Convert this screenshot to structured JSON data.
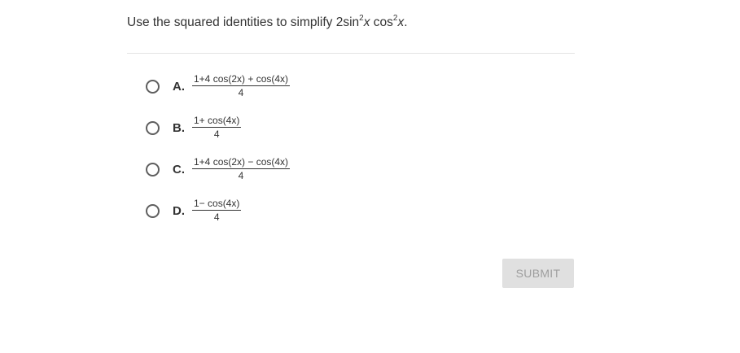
{
  "question": {
    "prefix": "Use the squared identities to simplify 2sin",
    "exp1": "2",
    "var1": "x",
    "mid": " cos",
    "exp2": "2",
    "var2": "x",
    "suffix": "."
  },
  "options": [
    {
      "letter": "A.",
      "numerator": "1+4 cos(2x) + cos(4x)",
      "denominator": "4"
    },
    {
      "letter": "B.",
      "numerator": "1+ cos(4x)",
      "denominator": "4"
    },
    {
      "letter": "C.",
      "numerator": "1+4 cos(2x) − cos(4x)",
      "denominator": "4"
    },
    {
      "letter": "D.",
      "numerator": "1− cos(4x)",
      "denominator": "4"
    }
  ],
  "submit": {
    "label": "SUBMIT",
    "disabled": true
  }
}
